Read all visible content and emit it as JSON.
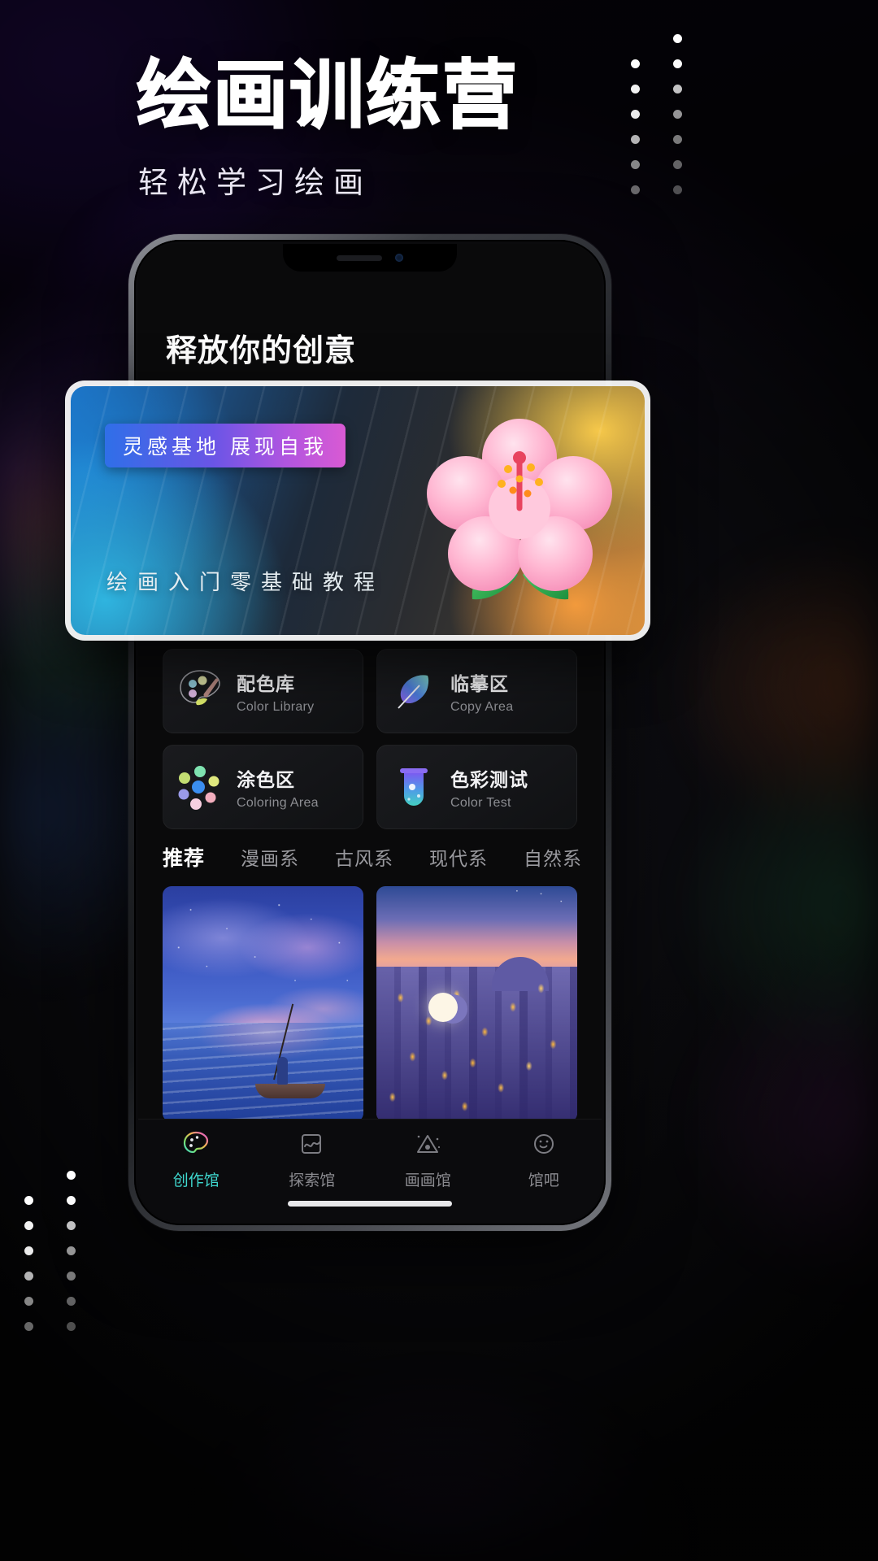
{
  "poster": {
    "title": "绘画训练营",
    "subtitle": "轻松学习绘画",
    "background_accent": "#5a20cf",
    "decor": {
      "dot_grid_icon": "dot-grid-decoration",
      "dot_columns": 2,
      "dot_rows": 7
    }
  },
  "phone": {
    "screen_heading": "释放你的创意",
    "feature_card": {
      "badge": "灵感基地 展现自我",
      "caption": "绘画入门零基础教程",
      "illustration_icon": "hibiscus-flower-icon",
      "badge_gradient_start": "#2f6fe8",
      "badge_gradient_end": "#d95ad3"
    },
    "menu": [
      {
        "cn": "配色库",
        "en": "Color Library",
        "icon": "palette-icon"
      },
      {
        "cn": "临摹区",
        "en": "Copy Area",
        "icon": "feather-quill-icon"
      },
      {
        "cn": "涂色区",
        "en": "Coloring Area",
        "icon": "color-dots-icon"
      },
      {
        "cn": "色彩测试",
        "en": "Color Test",
        "icon": "test-tube-icon"
      }
    ],
    "category_tabs": [
      {
        "label": "推荐",
        "active": true
      },
      {
        "label": "漫画系",
        "active": false
      },
      {
        "label": "古风系",
        "active": false
      },
      {
        "label": "现代系",
        "active": false
      },
      {
        "label": "自然系",
        "active": false
      }
    ],
    "artworks": [
      {
        "name": "starry-seascape-boat",
        "alt": "星空海面小舟"
      },
      {
        "name": "moonlit-town-sunset",
        "alt": "月夜小镇黄昏"
      }
    ],
    "bottom_nav": [
      {
        "label": "创作馆",
        "icon": "rainbow-palette-icon",
        "active": true,
        "active_color": "#3fd9d0"
      },
      {
        "label": "探索馆",
        "icon": "wave-frame-icon",
        "active": false
      },
      {
        "label": "画画馆",
        "icon": "triangle-sparkle-icon",
        "active": false
      },
      {
        "label": "馆吧",
        "icon": "smiley-face-icon",
        "active": false
      }
    ]
  }
}
